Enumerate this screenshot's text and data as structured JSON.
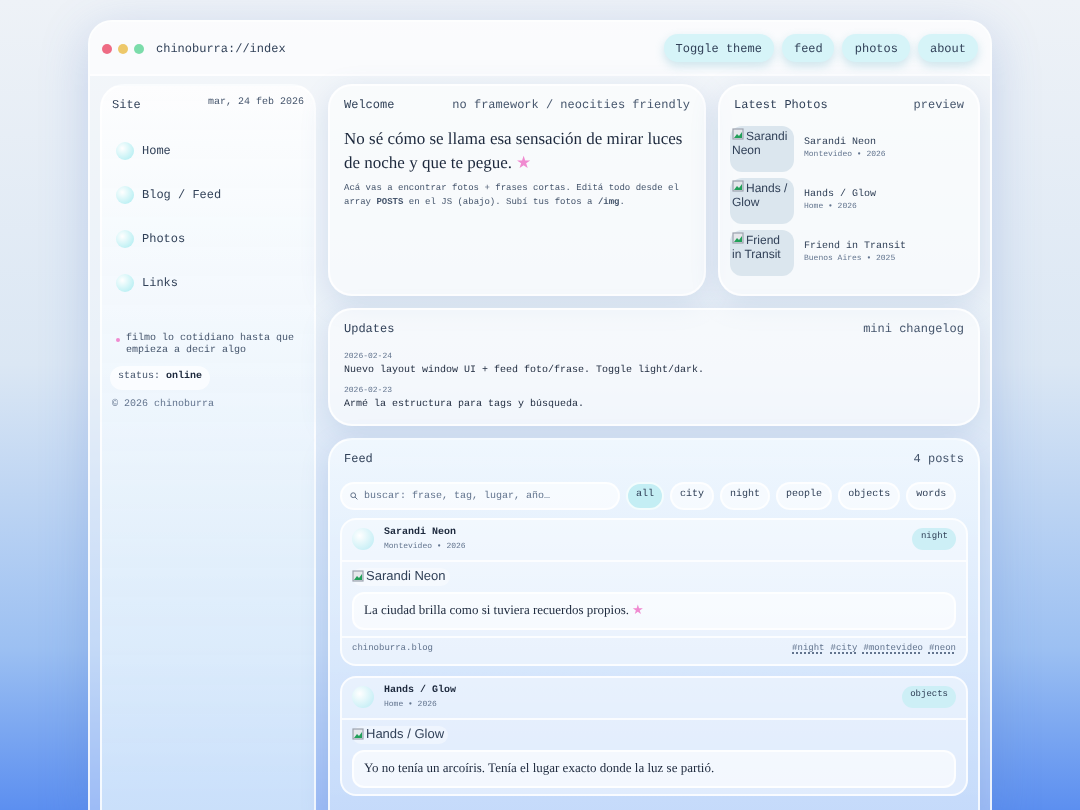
{
  "window": {
    "address": "chinoburra://index",
    "buttons": [
      "Toggle theme",
      "feed",
      "photos",
      "about"
    ]
  },
  "sidebar": {
    "title": "Site",
    "date": "mar, 24 feb 2026",
    "items": [
      "Home",
      "Blog / Feed",
      "Photos",
      "Links"
    ],
    "tagline": "filmo lo cotidiano hasta que empieza a decir algo",
    "status_label": "status:",
    "status_value": "online",
    "footer": "© 2026 chinoburra"
  },
  "welcome": {
    "title": "Welcome",
    "note": "no framework / neocities friendly",
    "heading": "No sé cómo se llama esa sensación de mirar luces de noche y que te pegue.",
    "mark": "★",
    "body": "Acá vas a encontrar fotos + frases cortas. Editá todo desde el array **POSTS** en el JS (abajo). Subí tus fotos a **/img**."
  },
  "latest_photos": {
    "title": "Latest Photos",
    "note": "preview",
    "items": [
      {
        "alt": "Sarandi Neon",
        "title": "Sarandi Neon",
        "meta": "Montevideo • 2026"
      },
      {
        "alt": "Hands / Glow",
        "title": "Hands / Glow",
        "meta": "Home • 2026"
      },
      {
        "alt": "Friend in Transit",
        "title": "Friend in Transit",
        "meta": "Buenos Aires • 2025"
      }
    ]
  },
  "updates": {
    "title": "Updates",
    "note": "mini changelog",
    "entries": [
      {
        "date": "2026-02-24",
        "text": "Nuevo layout window UI + feed foto/frase. Toggle light/dark."
      },
      {
        "date": "2026-02-23",
        "text": "Armé la estructura para tags y búsqueda."
      }
    ]
  },
  "feed": {
    "title": "Feed",
    "count": "4 posts",
    "search": {
      "placeholder": "buscar: frase, tag, lugar, año…"
    },
    "filters": [
      {
        "label": "all",
        "selected": true
      },
      {
        "label": "city",
        "selected": false
      },
      {
        "label": "night",
        "selected": false
      },
      {
        "label": "people",
        "selected": false
      },
      {
        "label": "objects",
        "selected": false
      },
      {
        "label": "words",
        "selected": false
      }
    ],
    "posts": [
      {
        "title": "Sarandi Neon",
        "meta": "Montevideo • 2026",
        "tag": "night",
        "alt": "Sarandi Neon",
        "quote": "La ciudad brilla como si tuviera recuerdos propios.",
        "mark": "★",
        "source": "chinoburra.blog",
        "hashtags": [
          "#night",
          "#city",
          "#montevideo",
          "#neon"
        ]
      },
      {
        "title": "Hands / Glow",
        "meta": "Home • 2026",
        "tag": "objects",
        "alt": "Hands / Glow",
        "quote": "Yo no tenía un arcoíris. Tenía el lugar exacto donde la luz se partió."
      }
    ]
  }
}
